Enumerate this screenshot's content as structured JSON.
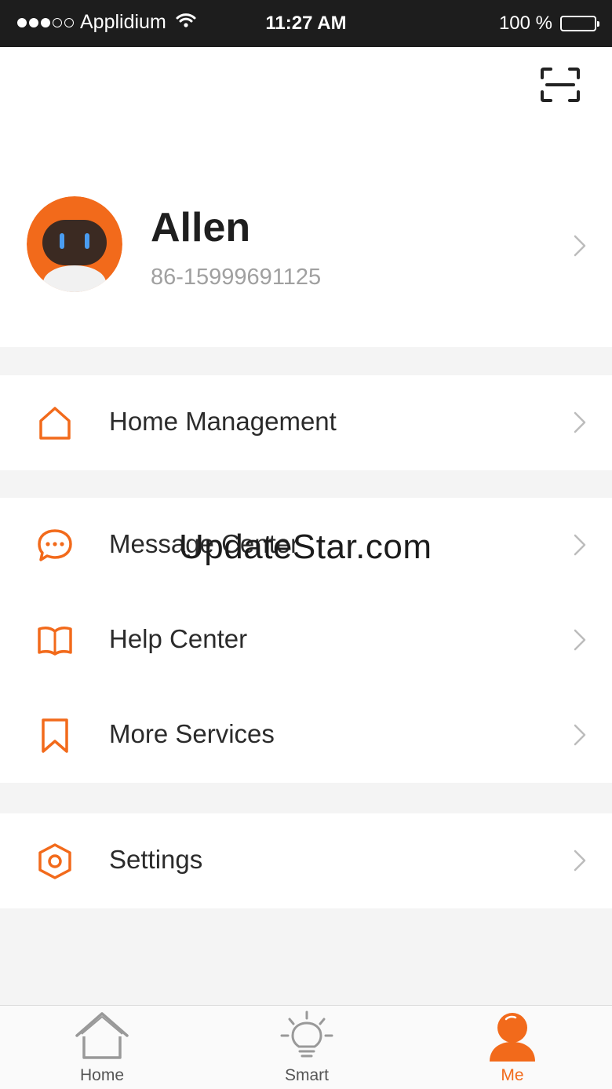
{
  "status_bar": {
    "carrier": "Applidium",
    "time": "11:27 AM",
    "battery": "100 %",
    "signal_bars_filled": 3,
    "signal_bars_total": 5
  },
  "header": {
    "scan_icon": "scan-icon"
  },
  "profile": {
    "name": "Allen",
    "phone": "86-15999691125",
    "avatar_icon": "robot-avatar"
  },
  "menu": {
    "home_management": {
      "label": "Home Management",
      "icon": "home-icon"
    },
    "message_center": {
      "label": "Message Center",
      "icon": "chat-bubble-icon"
    },
    "help_center": {
      "label": "Help Center",
      "icon": "book-icon"
    },
    "more_services": {
      "label": "More Services",
      "icon": "bookmark-icon"
    },
    "settings": {
      "label": "Settings",
      "icon": "hexagon-gear-icon"
    }
  },
  "watermark": "UpdateStar.com",
  "tabs": [
    {
      "label": "Home",
      "icon": "house-icon",
      "active": false
    },
    {
      "label": "Smart",
      "icon": "bulb-icon",
      "active": false
    },
    {
      "label": "Me",
      "icon": "person-icon",
      "active": true
    }
  ],
  "colors": {
    "accent": "#f26a1b",
    "status_bar_bg": "#1d1d1d",
    "separator_bg": "#f4f4f4"
  }
}
